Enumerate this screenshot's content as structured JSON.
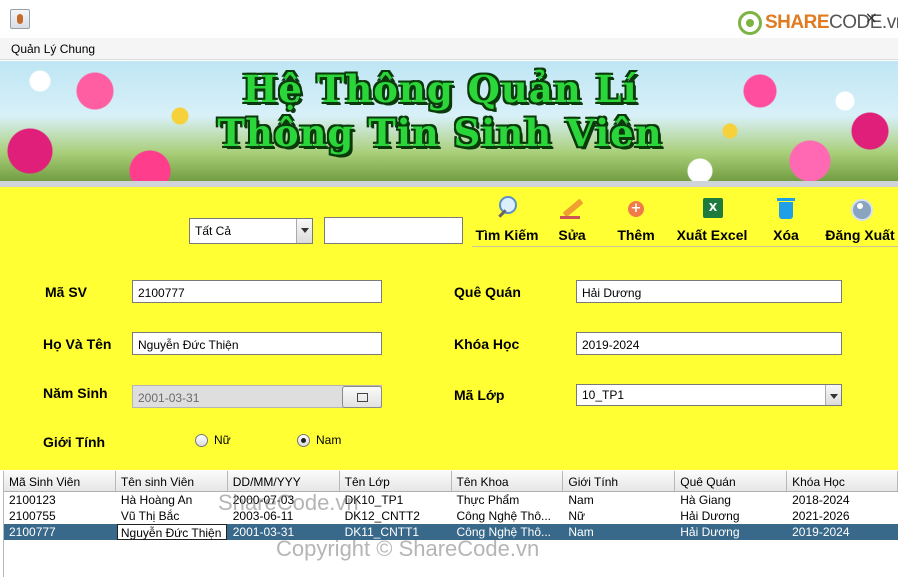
{
  "titlebar": {
    "brand_share": "SHARE",
    "brand_code": "CODE.vn",
    "close_glyph": "×"
  },
  "menubar": {
    "items": [
      "Quản Lý Chung"
    ]
  },
  "banner": {
    "title_line1": "Hệ Thông Quản Lí",
    "title_line2": "Thông Tin Sinh Viên"
  },
  "search": {
    "filter_selected": "Tất Cả",
    "query_value": ""
  },
  "toolbar": {
    "search_label": "Tìm Kiếm",
    "edit_label": "Sửa",
    "add_label": "Thêm",
    "export_label": "Xuất Excel",
    "delete_label": "Xóa",
    "logout_label": "Đăng Xuất"
  },
  "form": {
    "student_id_label": "Mã SV",
    "student_id_value": "2100777",
    "full_name_label": "Họ Và Tên",
    "full_name_value": "Nguyễn Đức Thiện",
    "birth_year_label": "Năm Sinh",
    "birth_year_value": "2001-03-31",
    "gender_label": "Giới Tính",
    "gender_female": "Nữ",
    "gender_male": "Nam",
    "hometown_label": "Quê Quán",
    "hometown_value": "Hải Dương",
    "course_label": "Khóa Học",
    "course_value": "2019-2024",
    "class_label": "Mã Lớp",
    "class_value": "10_TP1"
  },
  "table": {
    "columns": [
      "Mã Sinh Viên",
      "Tên sinh Viên",
      "DD/MM/YYY",
      "Tên Lớp",
      "Tên Khoa",
      "Giới Tính",
      "Quê Quán",
      "Khóa Học"
    ],
    "rows": [
      [
        "2100123",
        "Hà Hoàng An",
        "2000-07-03",
        "DK10_TP1",
        "Thực Phẩm",
        "Nam",
        "Hà Giang",
        "2018-2024"
      ],
      [
        "2100755",
        "Vũ Thị Bắc",
        "2003-06-11",
        "DK12_CNTT2",
        "Công Nghệ Thô...",
        "Nữ",
        "Hải Dương",
        "2021-2026"
      ],
      [
        "2100777",
        "Nguyễn Đức Thiện",
        "2001-03-31",
        "DK11_CNTT1",
        "Công Nghệ Thô...",
        "Nam",
        "Hải Dương",
        "2019-2024"
      ]
    ]
  },
  "watermarks": {
    "center": "ShareCode.vn",
    "bottom": "Copyright © ShareCode.vn"
  }
}
